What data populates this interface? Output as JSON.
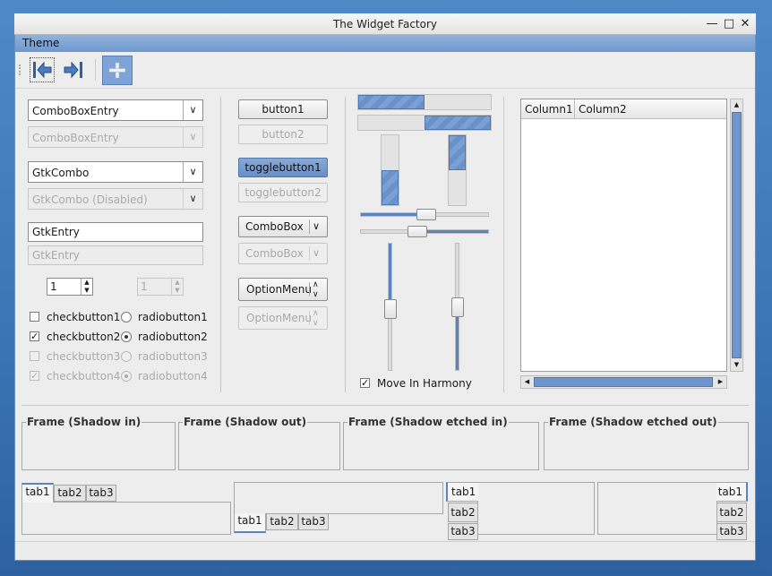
{
  "window": {
    "title": "The Widget Factory"
  },
  "menubar": {
    "items": [
      "Theme"
    ]
  },
  "toolbar": {
    "buttons": [
      "go-back-icon",
      "go-last-icon",
      "add-icon"
    ]
  },
  "left": {
    "combo_entry": "ComboBoxEntry",
    "combo_entry_disabled": "ComboBoxEntry",
    "gtk_combo": "GtkCombo",
    "gtk_combo_disabled": "GtkCombo (Disabled)",
    "entry": "GtkEntry",
    "entry_disabled": "GtkEntry",
    "spin": "1",
    "spin_disabled": "1",
    "checkbuttons": [
      {
        "label": "checkbutton1",
        "checked": false,
        "disabled": false
      },
      {
        "label": "checkbutton2",
        "checked": true,
        "disabled": false
      },
      {
        "label": "checkbutton3",
        "checked": false,
        "disabled": true
      },
      {
        "label": "checkbutton4",
        "checked": true,
        "disabled": true
      }
    ],
    "radiobuttons": [
      {
        "label": "radiobutton1",
        "selected": false,
        "disabled": false
      },
      {
        "label": "radiobutton2",
        "selected": true,
        "disabled": false
      },
      {
        "label": "radiobutton3",
        "selected": false,
        "disabled": true
      },
      {
        "label": "radiobutton4",
        "selected": true,
        "disabled": true
      }
    ]
  },
  "middle": {
    "button1": "button1",
    "button2": "button2",
    "toggle1": "togglebutton1",
    "toggle2": "togglebutton2",
    "combobox": "ComboBox",
    "combobox_disabled": "ComboBox",
    "optionmenu": "OptionMenu",
    "optionmenu_disabled": "OptionMenu"
  },
  "progress": {
    "h1_fraction": 0.5,
    "h2_fraction": 0.5,
    "v1_fraction": 0.5,
    "v2_fraction": 0.5,
    "hscale1": 0.52,
    "hscale2": 0.5,
    "vscale1": 0.52,
    "vscale2": 0.5,
    "harmony_label": "Move In Harmony",
    "harmony_checked": true
  },
  "tree": {
    "columns": [
      "Column1",
      "Column2"
    ]
  },
  "frames": [
    "Frame (Shadow in)",
    "Frame (Shadow out)",
    "Frame (Shadow etched in)",
    "Frame (Shadow etched out)"
  ],
  "notebooks": {
    "tabs": [
      "tab1",
      "tab2",
      "tab3"
    ]
  }
}
